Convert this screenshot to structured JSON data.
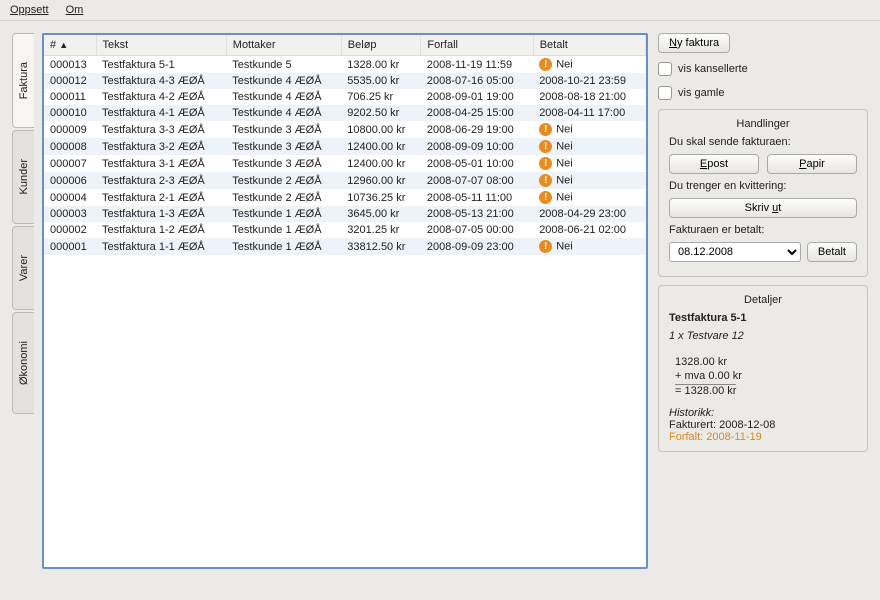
{
  "menu": {
    "oppsett": "Oppsett",
    "om": "Om"
  },
  "tabs": {
    "faktura": "Faktura",
    "kunder": "Kunder",
    "varer": "Varer",
    "okonomi": "Økonomi"
  },
  "columns": {
    "num": "#",
    "tekst": "Tekst",
    "mottaker": "Mottaker",
    "belop": "Beløp",
    "forfall": "Forfall",
    "betalt": "Betalt"
  },
  "rows": [
    {
      "num": "000013",
      "tekst": "Testfaktura 5-1",
      "mottaker": "Testkunde 5",
      "belop": "1328.00 kr",
      "forfall": "2008-11-19 11:59",
      "betalt": "Nei",
      "warn": true
    },
    {
      "num": "000012",
      "tekst": "Testfaktura 4-3 ÆØÅ",
      "mottaker": "Testkunde 4 ÆØÅ",
      "belop": "5535.00 kr",
      "forfall": "2008-07-16 05:00",
      "betalt": "2008-10-21 23:59",
      "warn": false
    },
    {
      "num": "000011",
      "tekst": "Testfaktura 4-2 ÆØÅ",
      "mottaker": "Testkunde 4 ÆØÅ",
      "belop": "706.25 kr",
      "forfall": "2008-09-01 19:00",
      "betalt": "2008-08-18 21:00",
      "warn": false
    },
    {
      "num": "000010",
      "tekst": "Testfaktura 4-1 ÆØÅ",
      "mottaker": "Testkunde 4 ÆØÅ",
      "belop": "9202.50 kr",
      "forfall": "2008-04-25 15:00",
      "betalt": "2008-04-11 17:00",
      "warn": false
    },
    {
      "num": "000009",
      "tekst": "Testfaktura 3-3 ÆØÅ",
      "mottaker": "Testkunde 3 ÆØÅ",
      "belop": "10800.00 kr",
      "forfall": "2008-06-29 19:00",
      "betalt": "Nei",
      "warn": true
    },
    {
      "num": "000008",
      "tekst": "Testfaktura 3-2 ÆØÅ",
      "mottaker": "Testkunde 3 ÆØÅ",
      "belop": "12400.00 kr",
      "forfall": "2008-09-09 10:00",
      "betalt": "Nei",
      "warn": true
    },
    {
      "num": "000007",
      "tekst": "Testfaktura 3-1 ÆØÅ",
      "mottaker": "Testkunde 3 ÆØÅ",
      "belop": "12400.00 kr",
      "forfall": "2008-05-01 10:00",
      "betalt": "Nei",
      "warn": true
    },
    {
      "num": "000006",
      "tekst": "Testfaktura 2-3 ÆØÅ",
      "mottaker": "Testkunde 2 ÆØÅ",
      "belop": "12960.00 kr",
      "forfall": "2008-07-07 08:00",
      "betalt": "Nei",
      "warn": true
    },
    {
      "num": "000004",
      "tekst": "Testfaktura 2-1 ÆØÅ",
      "mottaker": "Testkunde 2 ÆØÅ",
      "belop": "10736.25 kr",
      "forfall": "2008-05-11 11:00",
      "betalt": "Nei",
      "warn": true
    },
    {
      "num": "000003",
      "tekst": "Testfaktura 1-3 ÆØÅ",
      "mottaker": "Testkunde 1 ÆØÅ",
      "belop": "3645.00 kr",
      "forfall": "2008-05-13 21:00",
      "betalt": "2008-04-29 23:00",
      "warn": false
    },
    {
      "num": "000002",
      "tekst": "Testfaktura 1-2 ÆØÅ",
      "mottaker": "Testkunde 1 ÆØÅ",
      "belop": "3201.25 kr",
      "forfall": "2008-07-05 00:00",
      "betalt": "2008-06-21 02:00",
      "warn": false
    },
    {
      "num": "000001",
      "tekst": "Testfaktura 1-1 ÆØÅ",
      "mottaker": "Testkunde 1 ÆØÅ",
      "belop": "33812.50 kr",
      "forfall": "2008-09-09 23:00",
      "betalt": "Nei",
      "warn": true
    }
  ],
  "right": {
    "ny_faktura": "Ny faktura",
    "vis_kansellerte": "vis kansellerte",
    "vis_gamle": "vis gamle"
  },
  "handlinger": {
    "title": "Handlinger",
    "send_label": "Du skal sende fakturaen:",
    "epost": "Epost",
    "papir": "Papir",
    "kvittering_label": "Du trenger en kvittering:",
    "skriv_ut": "Skriv ut",
    "betalt_label": "Fakturaen er betalt:",
    "date": "08.12.2008",
    "betalt_btn": "Betalt"
  },
  "detaljer": {
    "title": "Detaljer",
    "name": "Testfaktura 5-1",
    "line": "1 x Testvare 12",
    "sum1": "1328.00 kr",
    "mva": "+ mva 0.00 kr",
    "total": "= 1328.00 kr",
    "hist": "Historikk:",
    "fakturert": "Fakturert: 2008-12-08",
    "forfalt": "Forfalt: 2008-11-19"
  }
}
